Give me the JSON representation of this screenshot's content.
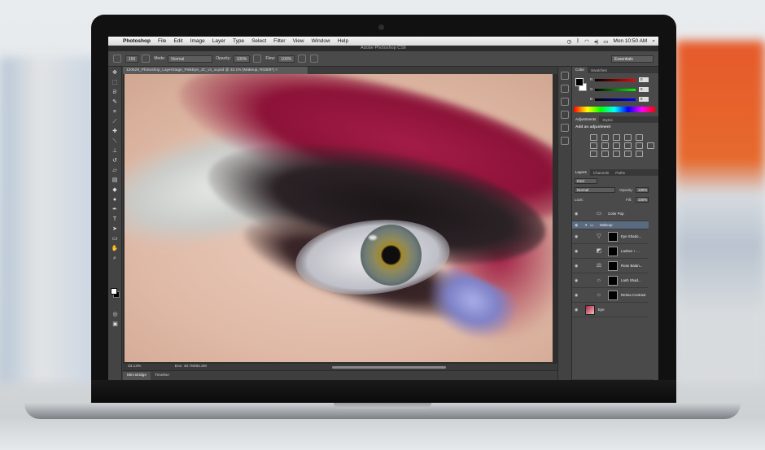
{
  "mac_menubar": {
    "app_name": "Photoshop",
    "menus": [
      "File",
      "Edit",
      "Image",
      "Layer",
      "Type",
      "Select",
      "Filter",
      "View",
      "Window",
      "Help"
    ],
    "clock": "Mon 10:50 AM"
  },
  "window_title": "Adobe Photoshop CS6",
  "options_bar": {
    "brush_size": "150",
    "mode_label": "Mode:",
    "mode_value": "Normal",
    "opacity_label": "Opacity:",
    "opacity_value": "100%",
    "flow_label": "Flow:",
    "flow_value": "100%",
    "workspace": "Essentials"
  },
  "document": {
    "tab_title": "120629_Photoshop_LayerStage_PinkEye_JC_v1_w.psd @ 33.1% (Makeup, RGB/8*) ×",
    "zoom": "33.13%",
    "doc_info": "Doc: 40.7M/84.2M"
  },
  "bottom_tabs": [
    "Mini Bridge",
    "Timeline"
  ],
  "color_panel": {
    "tabs": [
      "Color",
      "Swatches"
    ],
    "channels": [
      {
        "label": "R",
        "value": "0",
        "color": "#e03030"
      },
      {
        "label": "G",
        "value": "0",
        "color": "#30c030"
      },
      {
        "label": "B",
        "value": "0",
        "color": "#3050e0"
      }
    ]
  },
  "adjustments_panel": {
    "tabs": [
      "Adjustments",
      "Styles"
    ],
    "title": "Add an adjustment"
  },
  "layers_panel": {
    "tabs": [
      "Layers",
      "Channels",
      "Paths"
    ],
    "filter_kind": "Kind",
    "blend_mode": "Normal",
    "opacity_label": "Opacity:",
    "opacity_value": "100%",
    "lock_label": "Lock:",
    "fill_label": "Fill:",
    "fill_value": "100%",
    "layers": [
      {
        "name": "Color Pop",
        "type": "group-folder"
      },
      {
        "name": "Makeup",
        "type": "group-open",
        "selected": true
      },
      {
        "name": "Eye Shado...",
        "type": "adjustment"
      },
      {
        "name": "Lashes + ...",
        "type": "adjustment"
      },
      {
        "name": "Rose Balan...",
        "type": "adjustment"
      },
      {
        "name": "Lash Shad...",
        "type": "adjustment"
      },
      {
        "name": "Retina Contrast",
        "type": "adjustment"
      },
      {
        "name": "Eye",
        "type": "image"
      }
    ]
  }
}
